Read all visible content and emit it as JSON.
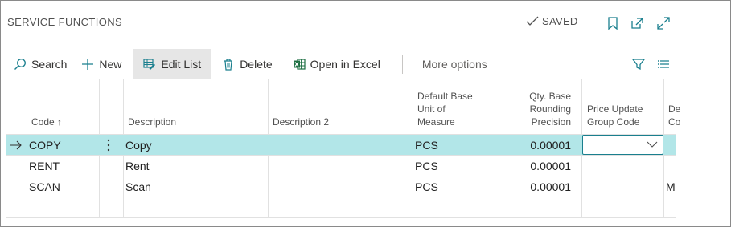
{
  "header": {
    "title": "SERVICE FUNCTIONS",
    "saved_label": "SAVED"
  },
  "actions": {
    "search": "Search",
    "new": "New",
    "edit_list": "Edit List",
    "delete": "Delete",
    "open_in_excel": "Open in Excel",
    "more_options": "More options"
  },
  "columns": {
    "code": "Code ↑",
    "description": "Description",
    "description2": "Description 2",
    "default_uom": "Default Base\nUnit of\nMeasure",
    "qty_rounding": "Qty. Base\nRounding\nPrecision",
    "price_group": "Price Update\nGroup Code",
    "extra": "De\nCo"
  },
  "rows": [
    {
      "code": "COPY",
      "description": "Copy",
      "description2": "",
      "uom": "PCS",
      "precision": "0.00001",
      "price_group": "",
      "extra": ""
    },
    {
      "code": "RENT",
      "description": "Rent",
      "description2": "",
      "uom": "PCS",
      "precision": "0.00001",
      "price_group": "",
      "extra": ""
    },
    {
      "code": "SCAN",
      "description": "Scan",
      "description2": "",
      "uom": "PCS",
      "precision": "0.00001",
      "price_group": "",
      "extra": "M"
    }
  ],
  "colors": {
    "accent": "#1a7f8e",
    "selected_row": "#b2e6e8",
    "excel_green": "#1d6f42"
  }
}
